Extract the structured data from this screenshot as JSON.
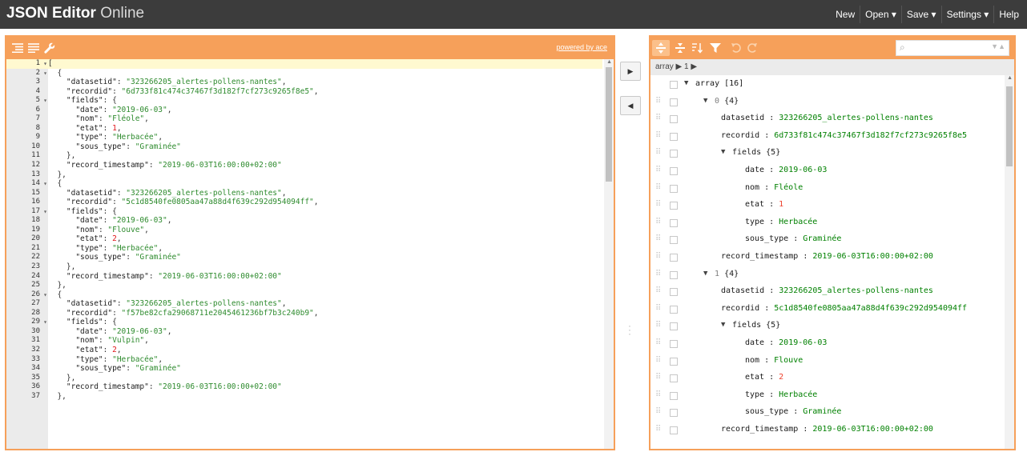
{
  "app": {
    "title_bold": "JSON Editor",
    "title_light": "Online"
  },
  "menu": [
    {
      "label": "New"
    },
    {
      "label": "Open ▾"
    },
    {
      "label": "Save ▾"
    },
    {
      "label": "Settings ▾"
    },
    {
      "label": "Help"
    }
  ],
  "left_panel": {
    "powered_by": "powered by ace",
    "icons": [
      "format-icon",
      "compact-icon",
      "repair-icon"
    ]
  },
  "code_lines": [
    {
      "num": "1",
      "fold": "-",
      "tokens": [
        [
          "p",
          "["
        ]
      ]
    },
    {
      "num": "2",
      "fold": "-",
      "tokens": [
        [
          "p",
          "  {"
        ]
      ]
    },
    {
      "num": "3",
      "fold": "",
      "tokens": [
        [
          "p",
          "    "
        ],
        [
          "k",
          "\"datasetid\""
        ],
        [
          "p",
          ": "
        ],
        [
          "s",
          "\"323266205_alertes-pollens-nantes\""
        ],
        [
          "p",
          ","
        ]
      ]
    },
    {
      "num": "4",
      "fold": "",
      "tokens": [
        [
          "p",
          "    "
        ],
        [
          "k",
          "\"recordid\""
        ],
        [
          "p",
          ": "
        ],
        [
          "s",
          "\"6d733f81c474c37467f3d182f7cf273c9265f8e5\""
        ],
        [
          "p",
          ","
        ]
      ]
    },
    {
      "num": "5",
      "fold": "-",
      "tokens": [
        [
          "p",
          "    "
        ],
        [
          "k",
          "\"fields\""
        ],
        [
          "p",
          ": {"
        ]
      ]
    },
    {
      "num": "6",
      "fold": "",
      "tokens": [
        [
          "p",
          "      "
        ],
        [
          "k",
          "\"date\""
        ],
        [
          "p",
          ": "
        ],
        [
          "s",
          "\"2019-06-03\""
        ],
        [
          "p",
          ","
        ]
      ]
    },
    {
      "num": "7",
      "fold": "",
      "tokens": [
        [
          "p",
          "      "
        ],
        [
          "k",
          "\"nom\""
        ],
        [
          "p",
          ": "
        ],
        [
          "s",
          "\"Fléole\""
        ],
        [
          "p",
          ","
        ]
      ]
    },
    {
      "num": "8",
      "fold": "",
      "tokens": [
        [
          "p",
          "      "
        ],
        [
          "k",
          "\"etat\""
        ],
        [
          "p",
          ": "
        ],
        [
          "n",
          "1"
        ],
        [
          "p",
          ","
        ]
      ]
    },
    {
      "num": "9",
      "fold": "",
      "tokens": [
        [
          "p",
          "      "
        ],
        [
          "k",
          "\"type\""
        ],
        [
          "p",
          ": "
        ],
        [
          "s",
          "\"Herbacée\""
        ],
        [
          "p",
          ","
        ]
      ]
    },
    {
      "num": "10",
      "fold": "",
      "tokens": [
        [
          "p",
          "      "
        ],
        [
          "k",
          "\"sous_type\""
        ],
        [
          "p",
          ": "
        ],
        [
          "s",
          "\"Graminée\""
        ]
      ]
    },
    {
      "num": "11",
      "fold": "",
      "tokens": [
        [
          "p",
          "    },"
        ]
      ]
    },
    {
      "num": "12",
      "fold": "",
      "tokens": [
        [
          "p",
          "    "
        ],
        [
          "k",
          "\"record_timestamp\""
        ],
        [
          "p",
          ": "
        ],
        [
          "s",
          "\"2019-06-03T16:00:00+02:00\""
        ]
      ]
    },
    {
      "num": "13",
      "fold": "",
      "tokens": [
        [
          "p",
          "  },"
        ]
      ]
    },
    {
      "num": "14",
      "fold": "-",
      "tokens": [
        [
          "p",
          "  {"
        ]
      ]
    },
    {
      "num": "15",
      "fold": "",
      "tokens": [
        [
          "p",
          "    "
        ],
        [
          "k",
          "\"datasetid\""
        ],
        [
          "p",
          ": "
        ],
        [
          "s",
          "\"323266205_alertes-pollens-nantes\""
        ],
        [
          "p",
          ","
        ]
      ]
    },
    {
      "num": "16",
      "fold": "",
      "tokens": [
        [
          "p",
          "    "
        ],
        [
          "k",
          "\"recordid\""
        ],
        [
          "p",
          ": "
        ],
        [
          "s",
          "\"5c1d8540fe0805aa47a88d4f639c292d954094ff\""
        ],
        [
          "p",
          ","
        ]
      ]
    },
    {
      "num": "17",
      "fold": "-",
      "tokens": [
        [
          "p",
          "    "
        ],
        [
          "k",
          "\"fields\""
        ],
        [
          "p",
          ": {"
        ]
      ]
    },
    {
      "num": "18",
      "fold": "",
      "tokens": [
        [
          "p",
          "      "
        ],
        [
          "k",
          "\"date\""
        ],
        [
          "p",
          ": "
        ],
        [
          "s",
          "\"2019-06-03\""
        ],
        [
          "p",
          ","
        ]
      ]
    },
    {
      "num": "19",
      "fold": "",
      "tokens": [
        [
          "p",
          "      "
        ],
        [
          "k",
          "\"nom\""
        ],
        [
          "p",
          ": "
        ],
        [
          "s",
          "\"Flouve\""
        ],
        [
          "p",
          ","
        ]
      ]
    },
    {
      "num": "20",
      "fold": "",
      "tokens": [
        [
          "p",
          "      "
        ],
        [
          "k",
          "\"etat\""
        ],
        [
          "p",
          ": "
        ],
        [
          "n",
          "2"
        ],
        [
          "p",
          ","
        ]
      ]
    },
    {
      "num": "21",
      "fold": "",
      "tokens": [
        [
          "p",
          "      "
        ],
        [
          "k",
          "\"type\""
        ],
        [
          "p",
          ": "
        ],
        [
          "s",
          "\"Herbacée\""
        ],
        [
          "p",
          ","
        ]
      ]
    },
    {
      "num": "22",
      "fold": "",
      "tokens": [
        [
          "p",
          "      "
        ],
        [
          "k",
          "\"sous_type\""
        ],
        [
          "p",
          ": "
        ],
        [
          "s",
          "\"Graminée\""
        ]
      ]
    },
    {
      "num": "23",
      "fold": "",
      "tokens": [
        [
          "p",
          "    },"
        ]
      ]
    },
    {
      "num": "24",
      "fold": "",
      "tokens": [
        [
          "p",
          "    "
        ],
        [
          "k",
          "\"record_timestamp\""
        ],
        [
          "p",
          ": "
        ],
        [
          "s",
          "\"2019-06-03T16:00:00+02:00\""
        ]
      ]
    },
    {
      "num": "25",
      "fold": "",
      "tokens": [
        [
          "p",
          "  },"
        ]
      ]
    },
    {
      "num": "26",
      "fold": "-",
      "tokens": [
        [
          "p",
          "  {"
        ]
      ]
    },
    {
      "num": "27",
      "fold": "",
      "tokens": [
        [
          "p",
          "    "
        ],
        [
          "k",
          "\"datasetid\""
        ],
        [
          "p",
          ": "
        ],
        [
          "s",
          "\"323266205_alertes-pollens-nantes\""
        ],
        [
          "p",
          ","
        ]
      ]
    },
    {
      "num": "28",
      "fold": "",
      "tokens": [
        [
          "p",
          "    "
        ],
        [
          "k",
          "\"recordid\""
        ],
        [
          "p",
          ": "
        ],
        [
          "s",
          "\"f57be82cfa29068711e2045461236bf7b3c240b9\""
        ],
        [
          "p",
          ","
        ]
      ]
    },
    {
      "num": "29",
      "fold": "-",
      "tokens": [
        [
          "p",
          "    "
        ],
        [
          "k",
          "\"fields\""
        ],
        [
          "p",
          ": {"
        ]
      ]
    },
    {
      "num": "30",
      "fold": "",
      "tokens": [
        [
          "p",
          "      "
        ],
        [
          "k",
          "\"date\""
        ],
        [
          "p",
          ": "
        ],
        [
          "s",
          "\"2019-06-03\""
        ],
        [
          "p",
          ","
        ]
      ]
    },
    {
      "num": "31",
      "fold": "",
      "tokens": [
        [
          "p",
          "      "
        ],
        [
          "k",
          "\"nom\""
        ],
        [
          "p",
          ": "
        ],
        [
          "s",
          "\"Vulpin\""
        ],
        [
          "p",
          ","
        ]
      ]
    },
    {
      "num": "32",
      "fold": "",
      "tokens": [
        [
          "p",
          "      "
        ],
        [
          "k",
          "\"etat\""
        ],
        [
          "p",
          ": "
        ],
        [
          "n",
          "2"
        ],
        [
          "p",
          ","
        ]
      ]
    },
    {
      "num": "33",
      "fold": "",
      "tokens": [
        [
          "p",
          "      "
        ],
        [
          "k",
          "\"type\""
        ],
        [
          "p",
          ": "
        ],
        [
          "s",
          "\"Herbacée\""
        ],
        [
          "p",
          ","
        ]
      ]
    },
    {
      "num": "34",
      "fold": "",
      "tokens": [
        [
          "p",
          "      "
        ],
        [
          "k",
          "\"sous_type\""
        ],
        [
          "p",
          ": "
        ],
        [
          "s",
          "\"Graminée\""
        ]
      ]
    },
    {
      "num": "35",
      "fold": "",
      "tokens": [
        [
          "p",
          "    },"
        ]
      ]
    },
    {
      "num": "36",
      "fold": "",
      "tokens": [
        [
          "p",
          "    "
        ],
        [
          "k",
          "\"record_timestamp\""
        ],
        [
          "p",
          ": "
        ],
        [
          "s",
          "\"2019-06-03T16:00:00+02:00\""
        ]
      ]
    },
    {
      "num": "37",
      "fold": "",
      "tokens": [
        [
          "p",
          "  },"
        ]
      ]
    }
  ],
  "middle": {
    "to_tree": "▶",
    "to_code": "◀"
  },
  "right_panel": {
    "icons": [
      "expand-all-icon",
      "collapse-all-icon",
      "sort-icon",
      "filter-icon",
      "undo-icon",
      "redo-icon"
    ],
    "search_placeholder": "",
    "navbar": "array ▶ 1 ▶"
  },
  "tree_rows": [
    {
      "depth": 0,
      "expand": "▼",
      "key": "array",
      "sep": "",
      "value": "[16]",
      "vtype": "meta",
      "drag": false
    },
    {
      "depth": 1,
      "expand": "▼",
      "key": "0",
      "sep": "",
      "value": "{4}",
      "vtype": "meta",
      "drag": true,
      "idx": true
    },
    {
      "depth": 2,
      "expand": "",
      "key": "datasetid",
      "sep": " : ",
      "value": "323266205_alertes-pollens-nantes",
      "vtype": "string",
      "drag": true
    },
    {
      "depth": 2,
      "expand": "",
      "key": "recordid",
      "sep": " : ",
      "value": "6d733f81c474c37467f3d182f7cf273c9265f8e5",
      "vtype": "string",
      "drag": true
    },
    {
      "depth": 2,
      "expand": "▼",
      "key": "fields",
      "sep": "",
      "value": "{5}",
      "vtype": "meta",
      "drag": true
    },
    {
      "depth": 3,
      "expand": "",
      "key": "date",
      "sep": " : ",
      "value": "2019-06-03",
      "vtype": "string",
      "drag": true
    },
    {
      "depth": 3,
      "expand": "",
      "key": "nom",
      "sep": "  : ",
      "value": "Fléole",
      "vtype": "string",
      "drag": true
    },
    {
      "depth": 3,
      "expand": "",
      "key": "etat",
      "sep": " : ",
      "value": "1",
      "vtype": "number",
      "drag": true
    },
    {
      "depth": 3,
      "expand": "",
      "key": "type",
      "sep": " : ",
      "value": "Herbacée",
      "vtype": "string",
      "drag": true
    },
    {
      "depth": 3,
      "expand": "",
      "key": "sous_type",
      "sep": " : ",
      "value": "Graminée",
      "vtype": "string",
      "drag": true
    },
    {
      "depth": 2,
      "expand": "",
      "key": "record_timestamp",
      "sep": " : ",
      "value": "2019-06-03T16:00:00+02:00",
      "vtype": "string",
      "drag": true
    },
    {
      "depth": 1,
      "expand": "▼",
      "key": "1",
      "sep": "",
      "value": "{4}",
      "vtype": "meta",
      "drag": true,
      "idx": true
    },
    {
      "depth": 2,
      "expand": "",
      "key": "datasetid",
      "sep": " : ",
      "value": "323266205_alertes-pollens-nantes",
      "vtype": "string",
      "drag": true
    },
    {
      "depth": 2,
      "expand": "",
      "key": "recordid",
      "sep": " : ",
      "value": "5c1d8540fe0805aa47a88d4f639c292d954094ff",
      "vtype": "string",
      "drag": true
    },
    {
      "depth": 2,
      "expand": "▼",
      "key": "fields",
      "sep": "",
      "value": "{5}",
      "vtype": "meta",
      "drag": true
    },
    {
      "depth": 3,
      "expand": "",
      "key": "date",
      "sep": " : ",
      "value": "2019-06-03",
      "vtype": "string",
      "drag": true
    },
    {
      "depth": 3,
      "expand": "",
      "key": "nom",
      "sep": "  : ",
      "value": "Flouve",
      "vtype": "string",
      "drag": true
    },
    {
      "depth": 3,
      "expand": "",
      "key": "etat",
      "sep": " : ",
      "value": "2",
      "vtype": "number",
      "drag": true
    },
    {
      "depth": 3,
      "expand": "",
      "key": "type",
      "sep": " : ",
      "value": "Herbacée",
      "vtype": "string",
      "drag": true
    },
    {
      "depth": 3,
      "expand": "",
      "key": "sous_type",
      "sep": " : ",
      "value": "Graminée",
      "vtype": "string",
      "drag": true
    },
    {
      "depth": 2,
      "expand": "",
      "key": "record_timestamp",
      "sep": " : ",
      "value": "2019-06-03T16:00:00+02:00",
      "vtype": "string",
      "drag": true
    }
  ],
  "colors": {
    "accent": "#f6a05a",
    "topbar": "#3c3c3c",
    "string": "#008000",
    "number": "#ee422e"
  }
}
